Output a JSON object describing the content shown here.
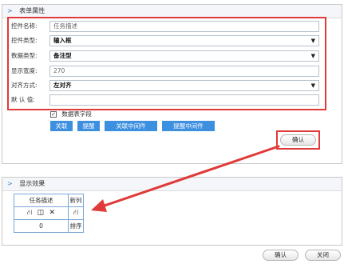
{
  "form_panel": {
    "title": "表单属性",
    "fields": [
      {
        "label": "控件名称:",
        "value": "任务描述"
      },
      {
        "label": "控件类型:",
        "value": "输入框"
      },
      {
        "label": "数据类型:",
        "value": "备注型"
      },
      {
        "label": "显示宽度:",
        "value": "270"
      },
      {
        "label": "对齐方式:",
        "value": "左对齐"
      },
      {
        "label": "默 认 值:",
        "value": ""
      }
    ],
    "checkbox_label": "数据表字段",
    "buttons": [
      "关联",
      "提醒",
      "关联中间件",
      "提醒中间件"
    ],
    "confirm_label": "确认"
  },
  "preview_panel": {
    "title": "显示效果",
    "header_cell": "任务描述",
    "new_column": "新列",
    "value_cell": "0",
    "sort_label": "排序"
  },
  "footer": {
    "confirm": "确认",
    "close": "关闭"
  },
  "colors": {
    "accent_blue": "#3d8fe0",
    "highlight_red": "#e03a3a"
  }
}
